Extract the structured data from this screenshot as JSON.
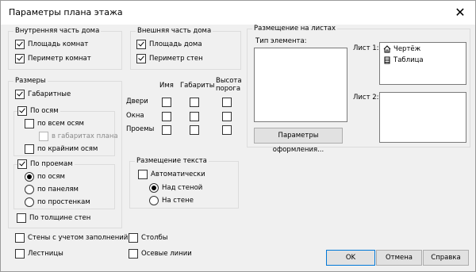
{
  "window": {
    "title": "Параметры плана этажа",
    "close_glyph": "✕"
  },
  "inner": {
    "title": "Внутренняя часть дома",
    "area": "Площадь комнат",
    "perimeter": "Периметр комнат"
  },
  "outer": {
    "title": "Внешняя часть дома",
    "area": "Площадь дома",
    "perimeter": "Периметр стен"
  },
  "sizes": {
    "title": "Размеры",
    "overall": "Габаритные",
    "by_axes": "По осям",
    "all_axes": "по всем осям",
    "in_plan": "в габаритах плана",
    "outer_axes": "по крайним осям",
    "by_openings": "По проемам",
    "r_axes": "по осям",
    "r_panels": "по панелям",
    "r_piers": "по простенкам",
    "wall_thickness": "По толщине стен"
  },
  "table": {
    "col_name": "Имя",
    "col_dims": "Габариты",
    "col_sill": "Высота порога",
    "rows": [
      "Двери",
      "Окна",
      "Проемы"
    ]
  },
  "text_placement": {
    "title": "Размещение текста",
    "auto": "Автоматически",
    "above": "Над стеной",
    "on": "На стене"
  },
  "sheets": {
    "title": "Размещение на листах",
    "element_type": "Тип элемента:",
    "sheet1": "Лист 1:",
    "sheet2": "Лист 2:",
    "items": [
      "Чертёж",
      "Таблица"
    ],
    "format_button": "Параметры оформления..."
  },
  "bottom": {
    "walls_fill": "Стены с учетом заполнений",
    "stairs": "Лестницы",
    "columns": "Столбы",
    "axis_lines": "Осевые линии"
  },
  "buttons": {
    "ok": "OK",
    "cancel": "Отмена",
    "help": "Справка"
  }
}
